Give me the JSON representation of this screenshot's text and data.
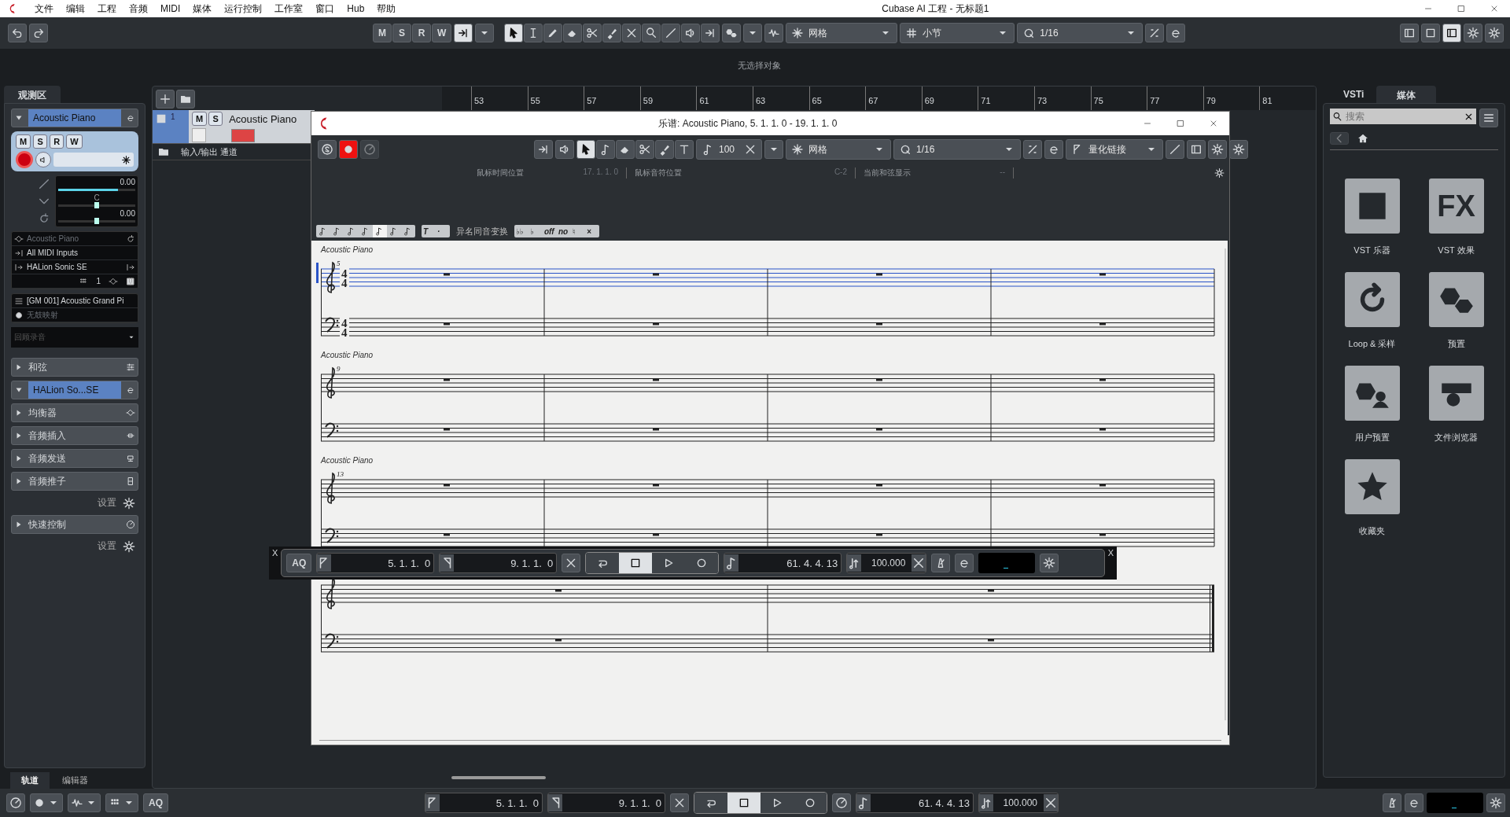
{
  "menu_bar": {
    "items": [
      "文件",
      "编辑",
      "工程",
      "音频",
      "MIDI",
      "媒体",
      "运行控制",
      "工作室",
      "窗口",
      "Hub",
      "帮助"
    ],
    "title": "Cubase AI 工程 - 无标题1"
  },
  "toolbar": {
    "buttons": [
      "M",
      "S",
      "R",
      "W"
    ],
    "tools": [
      {
        "selected": true
      },
      {
        "selected": false
      },
      {
        "selected": false
      },
      {
        "selected": false
      },
      {
        "selected": false
      },
      {
        "selected": false
      },
      {
        "selected": false
      },
      {
        "selected": false
      },
      {
        "selected": false
      },
      {
        "selected": false
      },
      {
        "selected": false
      }
    ],
    "snap_type": "网格",
    "grid": "小节",
    "quantize": "1/16"
  },
  "info_line": "无选择对象",
  "inspector": {
    "tab": "观测区",
    "track_name": "Acoustic Piano",
    "expanded": true,
    "buttons": [
      "M",
      "S",
      "R",
      "W"
    ],
    "volume": {
      "value": "0.00",
      "level": 0.78
    },
    "pan": {
      "value": "C",
      "level": 0.5
    },
    "delay": {
      "value": "0.00",
      "level": 0.5
    },
    "routing": [
      "Acoustic Piano",
      "All MIDI Inputs",
      "HALion Sonic SE"
    ],
    "channel": "1",
    "program": "[GM 001] Acoustic Grand Pi",
    "drum_map": "无鼓映射",
    "retro_record": "回顾录音",
    "sections": [
      {
        "kind": "section",
        "label": "和弦",
        "expanded": false
      },
      {
        "kind": "instrument",
        "label": "HALion So...SE",
        "expanded": true
      },
      {
        "kind": "section",
        "label": "均衡器",
        "expanded": false
      },
      {
        "kind": "section",
        "label": "音频插入",
        "expanded": false
      },
      {
        "kind": "section",
        "label": "音频发送",
        "expanded": false
      },
      {
        "kind": "section",
        "label": "音频推子",
        "expanded": false
      },
      {
        "kind": "settings",
        "label": "设置"
      },
      {
        "kind": "section",
        "label": "快速控制",
        "expanded": false
      },
      {
        "kind": "settings",
        "label": "设置"
      }
    ]
  },
  "bottom_tabs": [
    {
      "label": "轨道",
      "selected": true
    },
    {
      "label": "编辑器",
      "selected": false
    }
  ],
  "project": {
    "track": {
      "number": "1",
      "name": "Acoustic Piano",
      "buttons": [
        "M",
        "S"
      ],
      "checked": false
    },
    "folder": "输入/输出 通道",
    "ruler": [
      "53",
      "55",
      "57",
      "59",
      "61",
      "63",
      "65",
      "67",
      "69",
      "71",
      "73",
      "75",
      "77",
      "79",
      "81"
    ]
  },
  "score_window": {
    "title": "乐谱: Acoustic Piano, 5. 1. 1.  0 - 19. 1. 1.  0",
    "tools": [
      {
        "selected": true
      },
      {
        "selected": false
      },
      {
        "selected": false
      },
      {
        "selected": false
      },
      {
        "selected": false
      },
      {
        "selected": false
      }
    ],
    "velocity": "100",
    "snap_type": "网格",
    "quantize": "1/16",
    "quantize_link": "量化链接",
    "status": [
      {
        "label": "鼠标时间位置",
        "value": "17. 1. 1.   0"
      },
      {
        "label": "鼠标音符位置",
        "value": "C-2"
      },
      {
        "label": "当前和弦显示",
        "value": "--"
      }
    ],
    "note_values": [
      {
        "selected": false
      },
      {
        "selected": false
      },
      {
        "selected": false
      },
      {
        "selected": false
      },
      {
        "selected": true
      },
      {
        "selected": false
      },
      {
        "selected": false
      }
    ],
    "text_buttons": [
      "T",
      "·"
    ],
    "enharmonic_label": "异名同音变换",
    "enharmonic": [
      "♭♭",
      "♭",
      "off",
      "no",
      "♮",
      "×"
    ],
    "systems": [
      {
        "instrument": "Acoustic Piano",
        "measure": "5",
        "selected": true,
        "time_signature": {
          "treble": [
            "4",
            "4"
          ],
          "bass": [
            "4",
            "4"
          ]
        },
        "measures": [
          {
            "kind": "rest"
          },
          {
            "kind": "rest"
          },
          {
            "kind": "rest"
          },
          {
            "kind": "rest"
          }
        ]
      },
      {
        "instrument": "Acoustic Piano",
        "measure": "9",
        "selected": false,
        "measures": [
          {
            "kind": "rest"
          },
          {
            "kind": "rest"
          },
          {
            "kind": "rest"
          },
          {
            "kind": "rest"
          }
        ]
      },
      {
        "instrument": "Acoustic Piano",
        "measure": "13",
        "selected": false,
        "measures": [
          {
            "kind": "rest"
          },
          {
            "kind": "rest"
          },
          {
            "kind": "rest"
          },
          {
            "kind": "rest"
          }
        ]
      },
      {
        "selected": false,
        "final": true,
        "measures": [
          {
            "kind": "rest"
          },
          {
            "kind": "rest"
          }
        ]
      }
    ]
  },
  "floating_transport": {
    "close_left": "X",
    "close_right": "X",
    "aq": "AQ",
    "left_locator": "5. 1. 1.  0",
    "right_locator": "9. 1. 1.  0",
    "position": "61. 4. 4. 13",
    "tempo": "100.000"
  },
  "media_bay": {
    "tabs": [
      {
        "label": "VSTi",
        "selected": false
      },
      {
        "label": "媒体",
        "selected": true
      }
    ],
    "search": {
      "placeholder": "搜索"
    },
    "tiles": [
      {
        "label": "VST 乐器"
      },
      {
        "label": "VST 效果"
      },
      {
        "label": "Loop & 采样"
      },
      {
        "label": "预置"
      },
      {
        "label": "用户预置"
      },
      {
        "label": "文件浏览器"
      },
      {
        "label": "收藏夹"
      }
    ],
    "fx_text": "FX"
  },
  "transport": {
    "aq": "AQ",
    "left_locator": "5. 1. 1.  0",
    "right_locator": "9. 1. 1.  0",
    "position": "61. 4. 4. 13",
    "tempo": "100.000"
  }
}
